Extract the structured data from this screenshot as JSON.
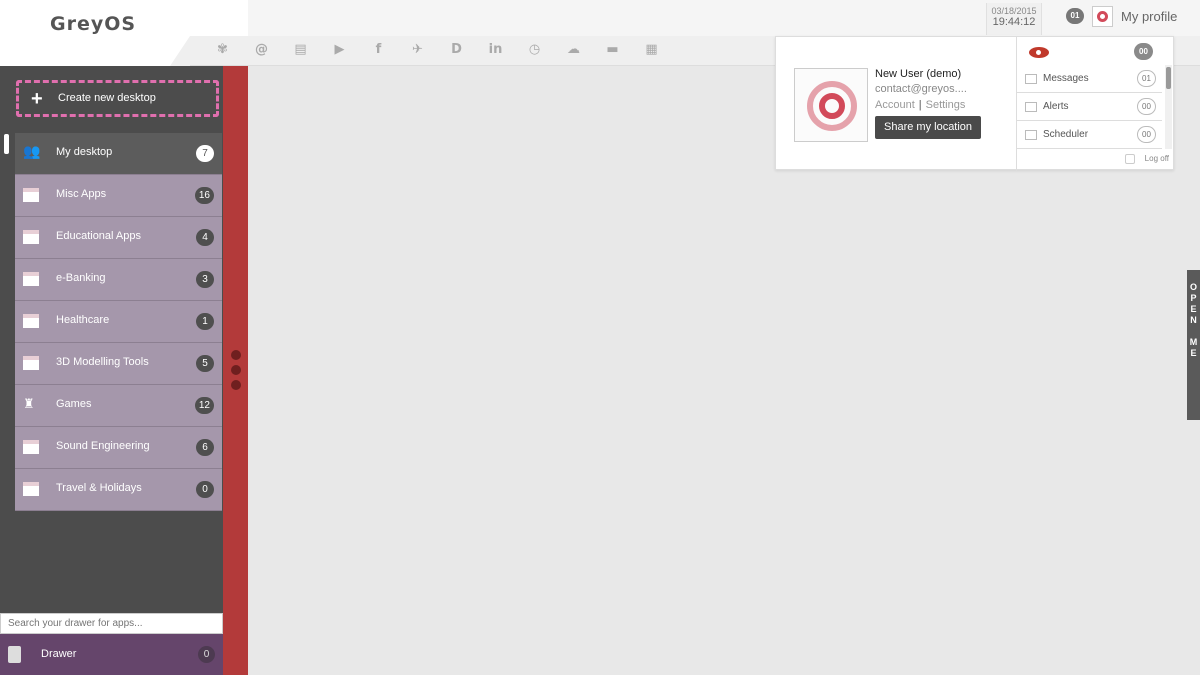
{
  "app": {
    "logo": "GreyOS"
  },
  "header": {
    "date": "03/18/2015",
    "time": "19:44:12",
    "notification_count": "01",
    "profile_label": "My profile",
    "social_icons": [
      "paw-icon",
      "at-icon",
      "card-icon",
      "youtube-icon",
      "facebook-icon",
      "twitter-icon",
      "disqus-icon",
      "linkedin-icon",
      "clock-icon",
      "cloud-icon",
      "chat-icon",
      "map-icon"
    ],
    "social_glyphs": [
      "✾",
      "@",
      "▤",
      "▶",
      "f",
      "✈",
      "D",
      "in",
      "◷",
      "☁",
      "▬",
      "▦"
    ]
  },
  "sidebar": {
    "create_label": "Create new desktop",
    "desktops": [
      {
        "name": "My desktop",
        "count": "7"
      },
      {
        "name": "Misc Apps",
        "count": "16"
      },
      {
        "name": "Educational Apps",
        "count": "4"
      },
      {
        "name": "e-Banking",
        "count": "3"
      },
      {
        "name": "Healthcare",
        "count": "1"
      },
      {
        "name": "3D Modelling Tools",
        "count": "5"
      },
      {
        "name": "Games",
        "count": "12"
      },
      {
        "name": "Sound Engineering",
        "count": "6"
      },
      {
        "name": "Travel & Holidays",
        "count": "0"
      }
    ],
    "search_placeholder": "Search your drawer for apps...",
    "drawer_label": "Drawer",
    "drawer_count": "0"
  },
  "profile_popup": {
    "user_name": "New User (demo)",
    "email": "contact@greyos....",
    "account_link": "Account",
    "settings_link": "Settings",
    "share_location": "Share my location",
    "visibility_count": "00",
    "notifications": [
      {
        "label": "Messages",
        "count": "01"
      },
      {
        "label": "Alerts",
        "count": "00"
      },
      {
        "label": "Scheduler",
        "count": "00"
      }
    ],
    "logoff": "Log off"
  },
  "side_tab": {
    "label": [
      "O",
      "P",
      "E",
      "N",
      "",
      "M",
      "E"
    ]
  },
  "colors": {
    "accent_red": "#b33a3a",
    "desk_purple": "#a597ab",
    "drawer_purple": "#65456b",
    "dashed_pink": "#e06fae"
  }
}
